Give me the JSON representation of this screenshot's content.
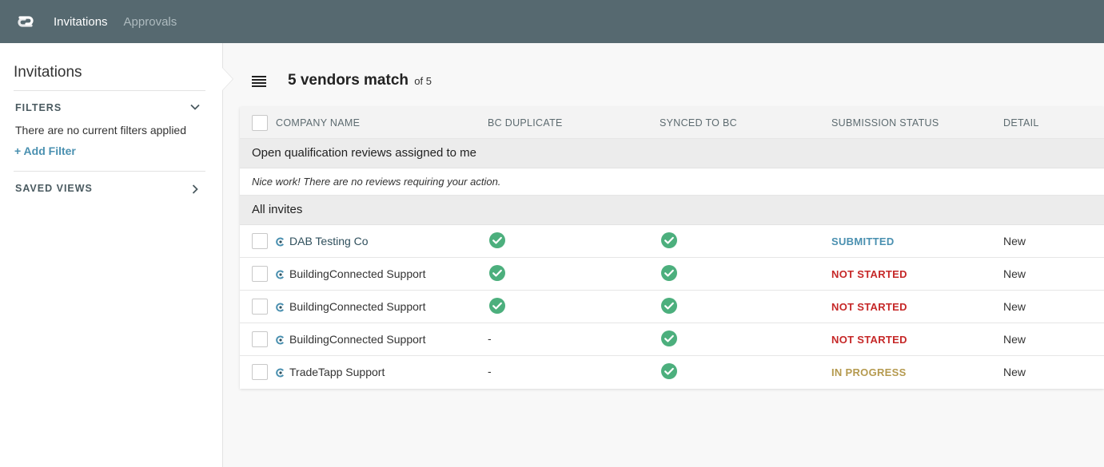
{
  "nav": {
    "items": [
      "Invitations",
      "Approvals"
    ]
  },
  "sidebar": {
    "title": "Invitations",
    "filters_label": "FILTERS",
    "filters_note": "There are no current filters applied",
    "add_filter": "+ Add Filter",
    "saved_views_label": "SAVED VIEWS"
  },
  "header": {
    "match_title": "5 vendors match",
    "match_sub": "of 5"
  },
  "table": {
    "columns": [
      "COMPANY NAME",
      "BC DUPLICATE",
      "SYNCED TO BC",
      "SUBMISSION STATUS",
      "DETAIL"
    ],
    "group_reviews": "Open qualification reviews assigned to me",
    "reviews_empty": "Nice work! There are no reviews requiring your action.",
    "group_all": "All invites",
    "rows": [
      {
        "company": "DAB Testing Co",
        "bc_duplicate": true,
        "synced": true,
        "status": "SUBMITTED",
        "detail": "New"
      },
      {
        "company": "BuildingConnected Support",
        "bc_duplicate": true,
        "synced": true,
        "status": "NOT STARTED",
        "detail": "New"
      },
      {
        "company": "BuildingConnected Support",
        "bc_duplicate": true,
        "synced": true,
        "status": "NOT STARTED",
        "detail": "New"
      },
      {
        "company": "BuildingConnected Support",
        "bc_duplicate": "-",
        "synced": true,
        "status": "NOT STARTED",
        "detail": "New"
      },
      {
        "company": "TradeTapp Support",
        "bc_duplicate": "-",
        "synced": true,
        "status": "IN PROGRESS",
        "detail": "New"
      }
    ]
  },
  "colors": {
    "topbar": "#566970",
    "check": "#4caf7d",
    "submitted": "#4a90b0",
    "not_started": "#c62828",
    "in_progress": "#b59a4f"
  },
  "icons": {
    "logo": "app-logo-icon",
    "chevron_down": "chevron-down-icon",
    "chevron_right": "chevron-right-icon",
    "menu": "hamburger-menu-icon",
    "check": "check-circle-icon",
    "company": "bc-company-icon"
  }
}
